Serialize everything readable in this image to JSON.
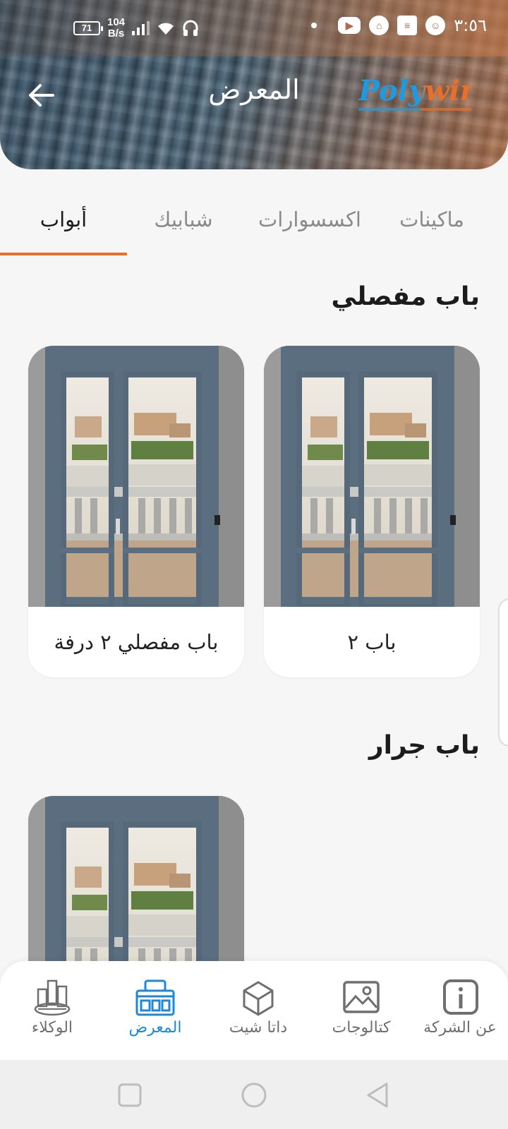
{
  "status_bar": {
    "battery": "71",
    "speed_value": "104",
    "speed_unit": "B/s",
    "time": "٣:٥٦"
  },
  "header": {
    "title": "المعرض",
    "logo_text": "Polywin",
    "colors": {
      "logo_blue": "#1e9be0",
      "logo_orange": "#e8702a"
    }
  },
  "tabs": [
    {
      "label": "ماكينات",
      "active": false
    },
    {
      "label": "اكسسوارات",
      "active": false
    },
    {
      "label": "شبابيك",
      "active": false
    },
    {
      "label": "أبواب",
      "active": true
    }
  ],
  "sections": [
    {
      "title": "باب مفصلي",
      "cards": [
        {
          "label": "باب ٢"
        },
        {
          "label": "باب مفصلي ٢ درفة"
        }
      ]
    },
    {
      "title": "باب جرار",
      "cards": [
        {
          "label": ""
        }
      ]
    }
  ],
  "bottom_nav": [
    {
      "label": "عن الشركة",
      "icon": "info-icon",
      "active": false
    },
    {
      "label": "كتالوجات",
      "icon": "image-icon",
      "active": false
    },
    {
      "label": "داتا شيت",
      "icon": "cube-icon",
      "active": false
    },
    {
      "label": "المعرض",
      "icon": "gallery-icon",
      "active": true
    },
    {
      "label": "الوكلاء",
      "icon": "city-icon",
      "active": false
    }
  ],
  "accent_color": "#e8702a",
  "active_nav_color": "#1e88d8"
}
